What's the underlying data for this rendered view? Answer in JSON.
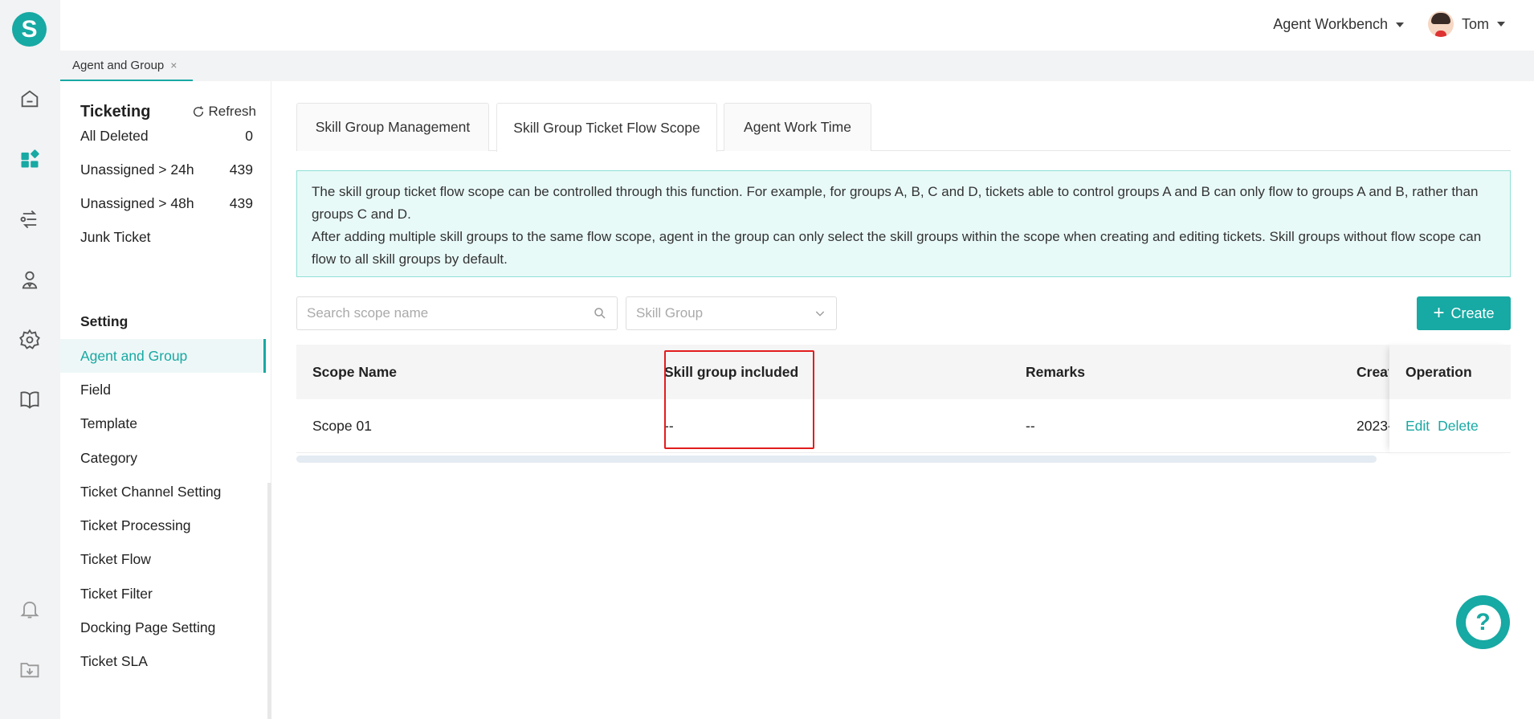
{
  "app": {
    "logo_letter": "S"
  },
  "topbar": {
    "workbench": "Agent Workbench",
    "user_name": "Tom"
  },
  "page_tab": {
    "label": "Agent and Group",
    "close": "×"
  },
  "sidebar": {
    "title": "Ticketing",
    "refresh": "Refresh",
    "counts": [
      {
        "label": "All Deleted",
        "count": "0"
      },
      {
        "label": "Unassigned > 24h",
        "count": "439"
      },
      {
        "label": "Unassigned > 48h",
        "count": "439"
      },
      {
        "label": "Junk Ticket",
        "count": ""
      }
    ],
    "section": "Setting",
    "items": [
      "Agent and Group",
      "Field",
      "Template",
      "Category",
      "Ticket Channel Setting",
      "Ticket Processing",
      "Ticket Flow",
      "Ticket Filter",
      "Docking Page Setting",
      "Ticket SLA"
    ]
  },
  "tabs": [
    "Skill Group Management",
    "Skill Group Ticket Flow Scope",
    "Agent Work Time"
  ],
  "notice": {
    "line1": "The skill group ticket flow scope can be controlled through this function. For example, for groups A, B, C and D, tickets able to control groups A and B can only flow to groups A and B, rather than groups C and D.",
    "line2": "After adding multiple skill groups to the same flow scope, agent in the group can only select the skill groups within the scope when creating and editing tickets. Skill groups without flow scope can flow to all skill groups by default."
  },
  "filters": {
    "search_placeholder": "Search scope name",
    "skill_group_placeholder": "Skill Group"
  },
  "create_button": "Create",
  "table": {
    "headers": [
      "Scope Name",
      "Skill group included",
      "Remarks",
      "Creat",
      "Operation"
    ],
    "rows": [
      {
        "scope": "Scope 01",
        "skill_group": "--",
        "remarks": "--",
        "created": "2023-",
        "edit": "Edit",
        "delete": "Delete"
      }
    ]
  },
  "help": "?",
  "colors": {
    "accent": "#17a9a3",
    "highlight": "#e21d1d"
  }
}
